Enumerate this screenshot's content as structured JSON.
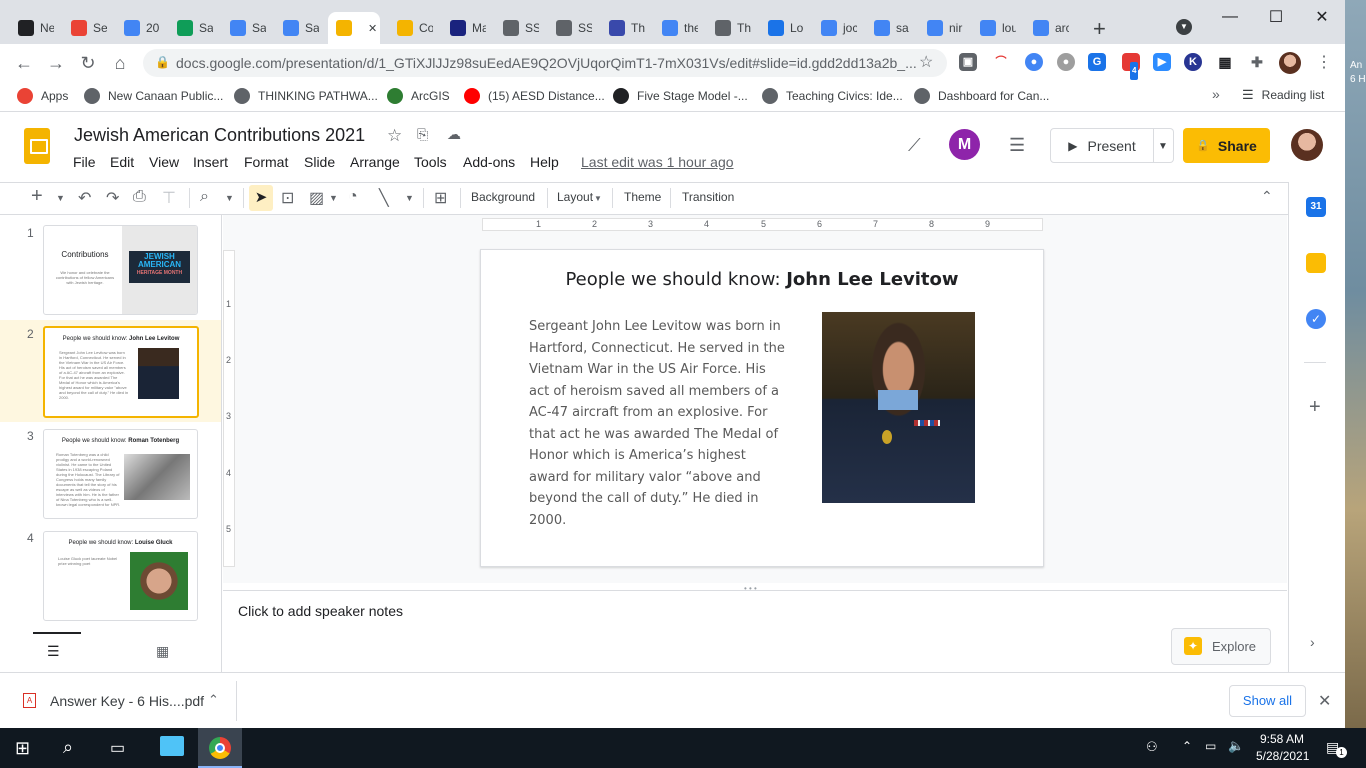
{
  "tabs": [
    {
      "label": "Ne",
      "icon": "github-icon",
      "color": "#202124"
    },
    {
      "label": "Se",
      "icon": "gmail-icon",
      "color": "#ea4335"
    },
    {
      "label": "20",
      "icon": "docs-icon",
      "color": "#4285f4"
    },
    {
      "label": "Sa",
      "icon": "drive-icon",
      "color": "#0f9d58"
    },
    {
      "label": "Sa",
      "icon": "docs-icon",
      "color": "#4285f4"
    },
    {
      "label": "Sa",
      "icon": "docs-icon",
      "color": "#4285f4"
    },
    {
      "label": "",
      "icon": "slides-icon",
      "color": "#f4b400",
      "active": true
    },
    {
      "label": "Co",
      "icon": "slides-icon",
      "color": "#f4b400"
    },
    {
      "label": "Ma",
      "icon": "tci-icon",
      "color": "#1a237e"
    },
    {
      "label": "SS",
      "icon": "globe-icon",
      "color": "#5f6368"
    },
    {
      "label": "SS",
      "icon": "globe-icon",
      "color": "#5f6368"
    },
    {
      "label": "Th",
      "icon": "circle-icon",
      "color": "#3949ab"
    },
    {
      "label": "the",
      "icon": "google-icon",
      "color": "#4285f4"
    },
    {
      "label": "Th",
      "icon": "globe-icon",
      "color": "#5f6368"
    },
    {
      "label": "Lo",
      "icon": "flag-icon",
      "color": "#1a73e8"
    },
    {
      "label": "joc",
      "icon": "google-icon",
      "color": "#4285f4"
    },
    {
      "label": "sa",
      "icon": "google-icon",
      "color": "#4285f4"
    },
    {
      "label": "nir",
      "icon": "google-icon",
      "color": "#4285f4"
    },
    {
      "label": "lou",
      "icon": "google-icon",
      "color": "#4285f4"
    },
    {
      "label": "arc",
      "icon": "google-icon",
      "color": "#4285f4"
    }
  ],
  "browser": {
    "url": "docs.google.com/presentation/d/1_GTiXJlJJz98suEedAE9Q2OVjUqorQimT1-7mX031Vs/edit#slide=id.gdd2dd13a2b_...",
    "ext_badge": "4"
  },
  "bookmarks": [
    {
      "label": "Apps",
      "icon": "apps-grid-icon",
      "color": "#ea4335"
    },
    {
      "label": "New Canaan Public...",
      "icon": "globe-icon",
      "color": "#5f6368"
    },
    {
      "label": "THINKING PATHWA...",
      "icon": "globe-icon",
      "color": "#5f6368"
    },
    {
      "label": "ArcGIS",
      "icon": "arcgis-icon",
      "color": "#2e7d32"
    },
    {
      "label": "(15) AESD Distance...",
      "icon": "youtube-icon",
      "color": "#ff0000"
    },
    {
      "label": "Five Stage Model -...",
      "icon": "w-icon",
      "color": "#202124"
    },
    {
      "label": "Teaching Civics: Ide...",
      "icon": "globe-icon",
      "color": "#5f6368"
    },
    {
      "label": "Dashboard for Can...",
      "icon": "globe-icon",
      "color": "#5f6368"
    }
  ],
  "reading_list": "Reading list",
  "desktop_text": [
    "An",
    "6 H"
  ],
  "docs": {
    "title": "Jewish American Contributions 2021",
    "menu": [
      "File",
      "Edit",
      "View",
      "Insert",
      "Format",
      "Slide",
      "Arrange",
      "Tools",
      "Add-ons",
      "Help"
    ],
    "last_edit": "Last edit was 1 hour ago",
    "present": "Present",
    "share": "Share"
  },
  "toolbar": {
    "background": "Background",
    "layout": "Layout",
    "theme": "Theme",
    "transition": "Transition"
  },
  "ruler_h": [
    "1",
    "2",
    "3",
    "4",
    "5",
    "6",
    "7",
    "8",
    "9"
  ],
  "ruler_v": [
    "1",
    "2",
    "3",
    "4",
    "5"
  ],
  "slides": [
    {
      "num": "1",
      "title": "Contributions",
      "body": "We honor and celebrate the contributions of fellow Americans with Jewish heritage.",
      "badge_lines": [
        "JEWISH",
        "AMERICAN",
        "HERITAGE MONTH"
      ]
    },
    {
      "num": "2",
      "title_plain": "People we should know: ",
      "title_bold": "John Lee Levitow",
      "body": "Sergeant John Lee Levitow was born in Hartford, Connecticut. He served in the Vietnam War in the US Air Force. His act of heroism saved all members of a AC-47 aircraft from an explosive. For that act he was awarded The Medal of Honor which is America's highest award for military valor \"above and beyond the call of duty.\" He died in 2000."
    },
    {
      "num": "3",
      "title_plain": "People we should know: ",
      "title_bold": "Roman Totenberg",
      "body": "Roman Totenberg was a child prodigy and a world-renowned violinist. He came to the United States in 1938 escaping Poland during the Holocaust. The Library of Congress holds many family documents that tell the story of his escape as well as videos of interviews with him. He is the father of Nina Totenberg who is a well-known legal correspondent for NPR."
    },
    {
      "num": "4",
      "title_plain": "People we should know: ",
      "title_bold": "Louise Gluck",
      "body": "Louise Gluck poet laureate Nobel prize winning poet"
    }
  ],
  "current_slide": {
    "title_plain": "People we should know: ",
    "title_bold": "John Lee Levitow",
    "body": "Sergeant John Lee Levitow was born in Hartford, Connecticut. He served in the Vietnam War in the US Air Force. His act of heroism saved all members of a AC-47 aircraft from an explosive. For that act he was awarded The Medal of Honor which is America’s highest award for military valor “above and beyond the call of duty.”   He died in 2000."
  },
  "notes": {
    "placeholder": "Click to add speaker notes"
  },
  "explore": "Explore",
  "download": {
    "file": "Answer Key - 6 His....pdf",
    "show_all": "Show all"
  },
  "taskbar": {
    "time": "9:58 AM",
    "date": "5/28/2021",
    "notification_count": "1"
  }
}
